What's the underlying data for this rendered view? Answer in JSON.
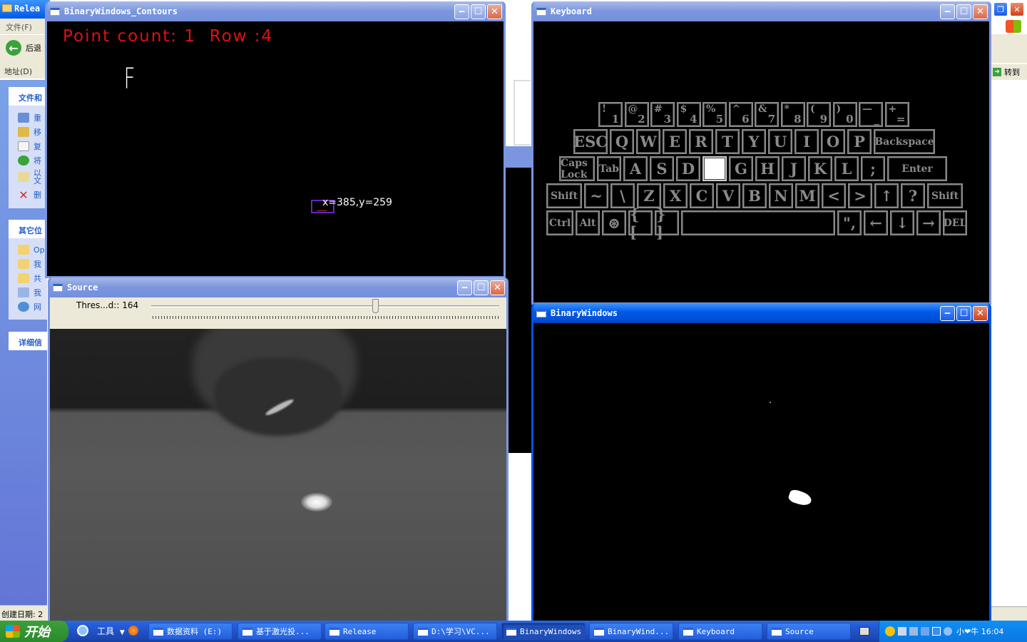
{
  "explorer": {
    "title": "Relea",
    "menu_file": "文件(F)",
    "back": "后退",
    "address_label": "地址(D)",
    "goto": "转到",
    "panel1_title": "文件和",
    "panel1_items": [
      "重",
      "移",
      "复",
      "将",
      "以文",
      "删"
    ],
    "panel2_title": "其它位",
    "panel2_items": [
      "Op",
      "我",
      "共",
      "我",
      "网"
    ],
    "panel3_title": "详细信",
    "created_label": "创建日期: 2"
  },
  "contours_window": {
    "title": "BinaryWindows_Contours",
    "status": "Point count: 1  Row :4",
    "letter": "F",
    "coords": "x=385,y=259"
  },
  "keyboard_window": {
    "title": "Keyboard",
    "rows": [
      [
        {
          "u": "!",
          "d": "1"
        },
        {
          "u": "@",
          "d": "2"
        },
        {
          "u": "#",
          "d": "3"
        },
        {
          "u": "$",
          "d": "4"
        },
        {
          "u": "%",
          "d": "5"
        },
        {
          "u": "^",
          "d": "6"
        },
        {
          "u": "&",
          "d": "7"
        },
        {
          "u": "*",
          "d": "8"
        },
        {
          "u": "(",
          "d": "9"
        },
        {
          "u": ")",
          "d": "0"
        },
        {
          "u": "—",
          "d": "_"
        },
        {
          "u": "+",
          "d": "="
        }
      ],
      [
        "ESC",
        "Q",
        "W",
        "E",
        "R",
        "T",
        "Y",
        "U",
        "I",
        "O",
        "P",
        "Backspace"
      ],
      [
        "Caps Lock",
        "Tab",
        "A",
        "S",
        "D",
        "",
        "G",
        "H",
        "J",
        "K",
        "L",
        ";",
        "Enter"
      ],
      [
        "Shift",
        "~",
        "\\",
        "Z",
        "X",
        "C",
        "V",
        "B",
        "N",
        "M",
        "<",
        ">",
        "↑",
        "?",
        "Shift"
      ],
      [
        "Ctrl",
        "Alt",
        "⊛",
        "{ [",
        "} ]",
        "",
        "\",",
        "←",
        "↓",
        "→",
        "DEL"
      ]
    ],
    "highlighted_key": "F"
  },
  "source_window": {
    "title": "Source",
    "slider_label": "Thres...d:: 164",
    "slider_value": 164,
    "slider_max": 255
  },
  "binary_window": {
    "title": "BinaryWindows"
  },
  "taskbar": {
    "start": "开始",
    "tools": "工具",
    "items": [
      {
        "label": "数据资料 (E:)",
        "active": false
      },
      {
        "label": "基于激光投...",
        "active": false
      },
      {
        "label": "Release",
        "active": false
      },
      {
        "label": "D:\\学习\\VC...",
        "active": false
      },
      {
        "label": "BinaryWindows",
        "active": true
      },
      {
        "label": "BinaryWind...",
        "active": false
      },
      {
        "label": "Keyboard",
        "active": false
      },
      {
        "label": "Source",
        "active": false
      }
    ],
    "clock": "小❤牛 16:04"
  },
  "colors": {
    "xp_blue": "#0054e3",
    "contour_text": "#e01010",
    "key_gray": "#888888"
  }
}
